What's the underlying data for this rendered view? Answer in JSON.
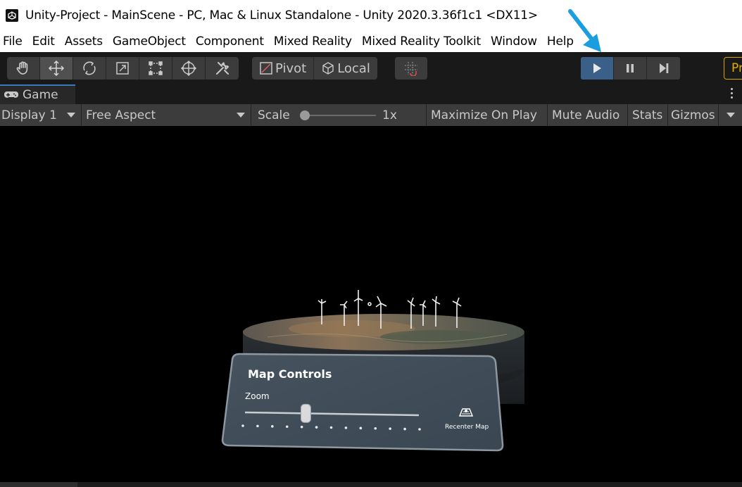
{
  "window": {
    "title": "Unity-Project - MainScene - PC, Mac & Linux Standalone - Unity 2020.3.36f1c1 <DX11>"
  },
  "menu": {
    "items": [
      "File",
      "Edit",
      "Assets",
      "GameObject",
      "Component",
      "Mixed Reality",
      "Mixed Reality Toolkit",
      "Window",
      "Help"
    ]
  },
  "toolbar": {
    "tools": [
      "hand-tool",
      "move-tool",
      "rotate-tool",
      "scale-tool",
      "rect-tool",
      "transform-tool",
      "custom-tool"
    ],
    "active_tool": "move-tool",
    "pivot_label": "Pivot",
    "local_label": "Local",
    "playback": {
      "playing": true
    },
    "right_cut_label": "Pr"
  },
  "game_tab": {
    "label": "Game"
  },
  "game_bar": {
    "display": "Display 1",
    "aspect": "Free Aspect",
    "scale_label": "Scale",
    "scale_value": "1x",
    "maximize": "Maximize On Play",
    "mute": "Mute Audio",
    "stats": "Stats",
    "gizmos": "Gizmos"
  },
  "map_controls": {
    "title": "Map Controls",
    "zoom_label": "Zoom",
    "zoom_level": 0.35,
    "recenter_label": "Recenter Map",
    "tick_count": 13
  },
  "colors": {
    "play_active": "#3a5f88",
    "annotation_arrow": "#1a9ee0",
    "pr_accent": "#e0b000"
  }
}
